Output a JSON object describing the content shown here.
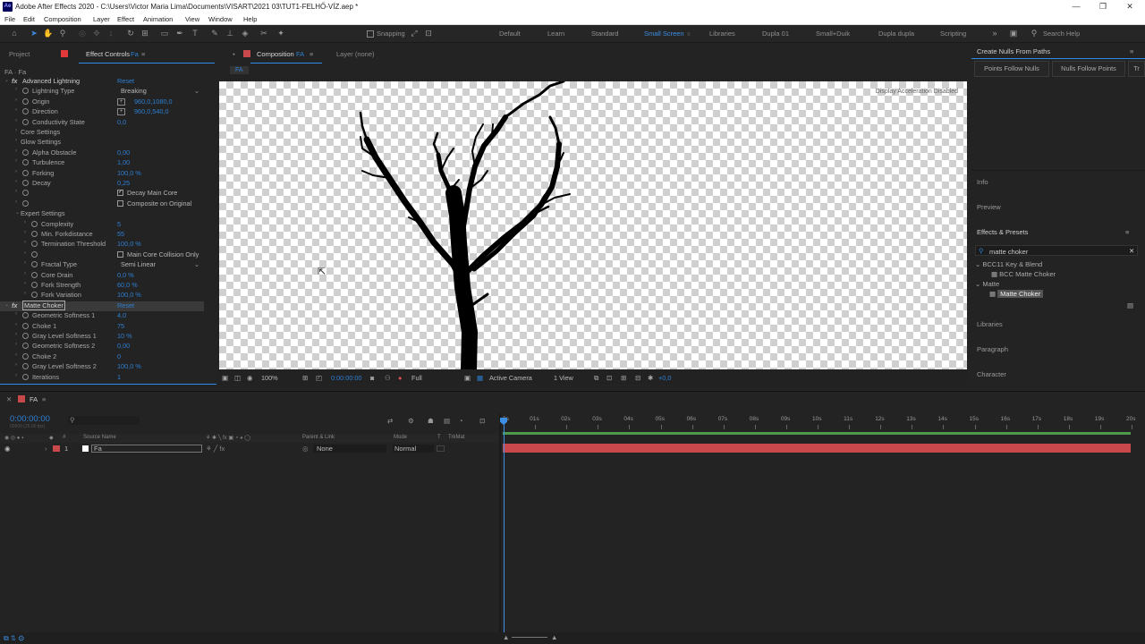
{
  "title_bar": {
    "title": "Adobe After Effects 2020 - C:\\Users\\Victor Maria Lima\\Documents\\VISART\\2021 03\\TUT1-FELHŐ-VÍZ.aep *",
    "logo": "Ae"
  },
  "menu": [
    "File",
    "Edit",
    "Composition",
    "Layer",
    "Effect",
    "Animation",
    "View",
    "Window",
    "Help"
  ],
  "toolbar": {
    "snapping_label": "Snapping",
    "workspaces": [
      "Default",
      "Learn",
      "Standard",
      "Small Screen",
      "Libraries",
      "Dupla 01",
      "Small+Duik",
      "Dupla dupla",
      "Scripting"
    ],
    "active_workspace": "Small Screen",
    "search_help": "Search Help"
  },
  "effect_panel": {
    "tab_project": "Project",
    "tab_effect": "Effect Controls",
    "tab_effect_layer": "Fa",
    "header": "FA · Fa",
    "effects": [
      {
        "name": "Advanced Lightning",
        "reset": "Reset",
        "props": [
          {
            "label": "Lightning Type",
            "dropdown": "Breaking"
          },
          {
            "label": "Origin",
            "value": "960,0,1080,0",
            "xy": true
          },
          {
            "label": "Direction",
            "value": "960,0,540,0",
            "xy": true
          },
          {
            "label": "Conductivity State",
            "value": "0,0"
          },
          {
            "label": "Core Settings",
            "group": true
          },
          {
            "label": "Glow Settings",
            "group": true
          },
          {
            "label": "Alpha Obstacle",
            "value": "0,00"
          },
          {
            "label": "Turbulence",
            "value": "1,00"
          },
          {
            "label": "Forking",
            "value": "100,0 %"
          },
          {
            "label": "Decay",
            "value": "0,25"
          },
          {
            "label": "",
            "checkbox": "Decay Main Core",
            "checked": true
          },
          {
            "label": "",
            "checkbox": "Composite on Original",
            "checked": false
          },
          {
            "label": "Expert Settings",
            "group": true,
            "open": true
          },
          {
            "label": "Complexity",
            "value": "5",
            "sub": true
          },
          {
            "label": "Min. Forkdistance",
            "value": "55",
            "sub": true
          },
          {
            "label": "Termination Threshold",
            "value": "100,0 %",
            "sub": true
          },
          {
            "label": "",
            "checkbox": "Main Core Collision Only",
            "checked": false,
            "sub": true
          },
          {
            "label": "Fractal Type",
            "dropdown": "Semi Linear",
            "sub": true
          },
          {
            "label": "Core Drain",
            "value": "0,0 %",
            "sub": true
          },
          {
            "label": "Fork Strength",
            "value": "60,0 %",
            "sub": true
          },
          {
            "label": "Fork Variation",
            "value": "100,0 %",
            "sub": true
          }
        ]
      },
      {
        "name": "Matte Choker",
        "reset": "Reset",
        "props": [
          {
            "label": "Geometric Softness 1",
            "value": "4,0"
          },
          {
            "label": "Choke 1",
            "value": "75"
          },
          {
            "label": "Gray Level Softness 1",
            "value": "10 %"
          },
          {
            "label": "Geometric Softness 2",
            "value": "0,00"
          },
          {
            "label": "Choke 2",
            "value": "0"
          },
          {
            "label": "Gray Level Softness 2",
            "value": "100,0 %"
          },
          {
            "label": "Iterations",
            "value": "1"
          }
        ]
      }
    ]
  },
  "comp_panel": {
    "tab": "Composition",
    "tab_name": "FA",
    "layer_tab": "Layer (none)",
    "breadcrumb": "FA",
    "gpu_note": "Display Acceleration Disabled",
    "bottom": {
      "zoom": "100%",
      "timecode": "0:00:00:00",
      "resolution": "Full",
      "camera": "Active Camera",
      "views": "1 View",
      "exposure": "+0,0"
    }
  },
  "right_panel": {
    "title": "Create Nulls From Paths",
    "buttons": [
      "Points Follow Nulls",
      "Nulls Follow Points",
      "Tr"
    ],
    "sections": [
      "Info",
      "Preview",
      "Effects & Presets",
      "Libraries",
      "Paragraph",
      "Character"
    ],
    "search_value": "matte choker",
    "tree": [
      {
        "label": "BCC11 Key & Blend",
        "children": [
          "BCC Matte Choker"
        ]
      },
      {
        "label": "Matte",
        "children": [
          "Matte Choker"
        ]
      }
    ]
  },
  "timeline": {
    "tab": "FA",
    "timecode": "0:00:00:00",
    "fps_note": "00000 (25.00 fps)",
    "columns": {
      "source": "Source Name",
      "parent": "Parent & Link",
      "mode": "Mode",
      "t": "T",
      "trkmat": "TrkMat"
    },
    "layer": {
      "index": "1",
      "name": "Fa",
      "parent": "None",
      "mode": "Normal"
    },
    "ruler": [
      "0s",
      "01s",
      "02s",
      "03s",
      "04s",
      "05s",
      "06s",
      "07s",
      "08s",
      "09s",
      "10s",
      "11s",
      "12s",
      "13s",
      "14s",
      "15s",
      "16s",
      "17s",
      "18s",
      "19s",
      "20s"
    ]
  },
  "colors": {
    "accent": "#2d8ceb",
    "layer_bar": "#c8484c",
    "work_area": "#4d9a4d"
  }
}
